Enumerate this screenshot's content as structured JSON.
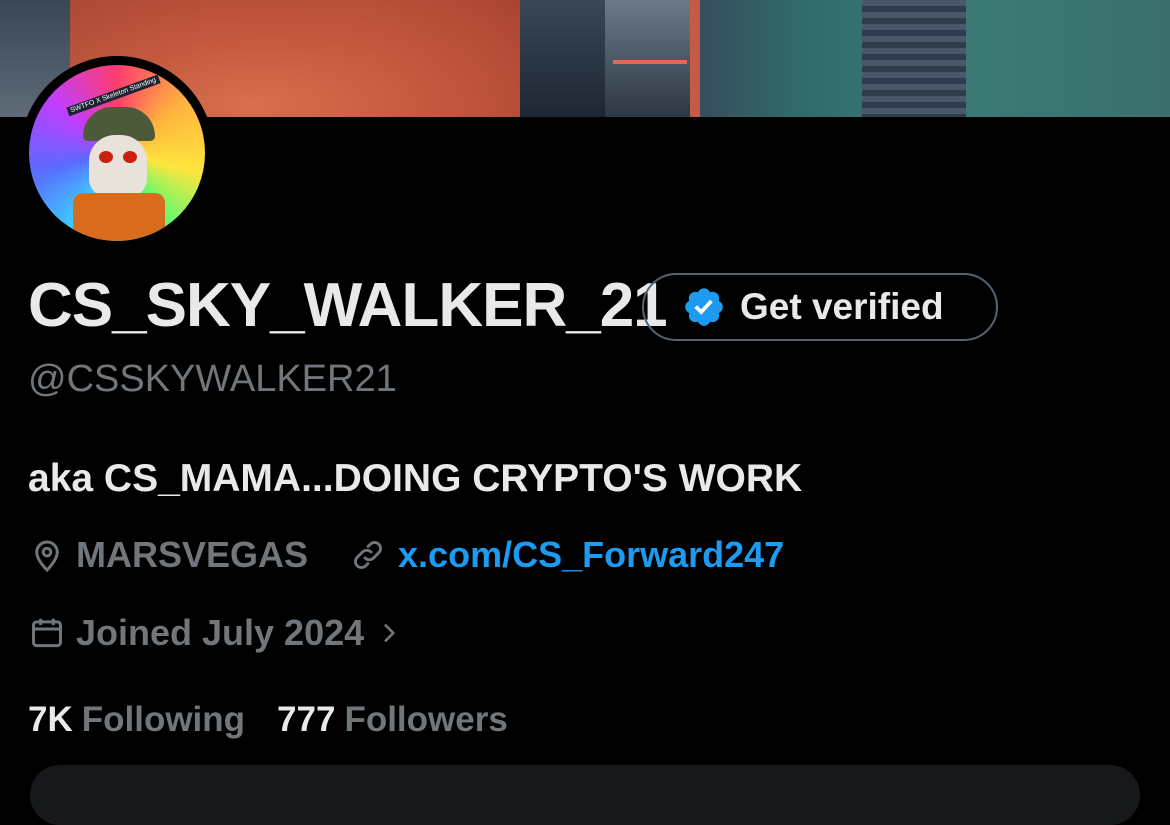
{
  "profile": {
    "display_name": "CS_SKY_WALKER_21",
    "handle": "@CSSKYWALKER21",
    "bio": "aka CS_MAMA...DOING CRYPTO'S WORK",
    "location": "MARSVEGAS",
    "website": "x.com/CS_Forward247",
    "joined": "Joined July 2024",
    "avatar_caption": "SWTFO X Skeleton Standing"
  },
  "verify_button": {
    "label": "Get verified"
  },
  "stats": {
    "following_count": "7K",
    "following_label": "Following",
    "followers_count": "777",
    "followers_label": "Followers"
  },
  "colors": {
    "background": "#000000",
    "text_primary": "#e7e9ea",
    "text_secondary": "#71767b",
    "link": "#1d9bf0",
    "verified_badge": "#1d9bf0"
  }
}
